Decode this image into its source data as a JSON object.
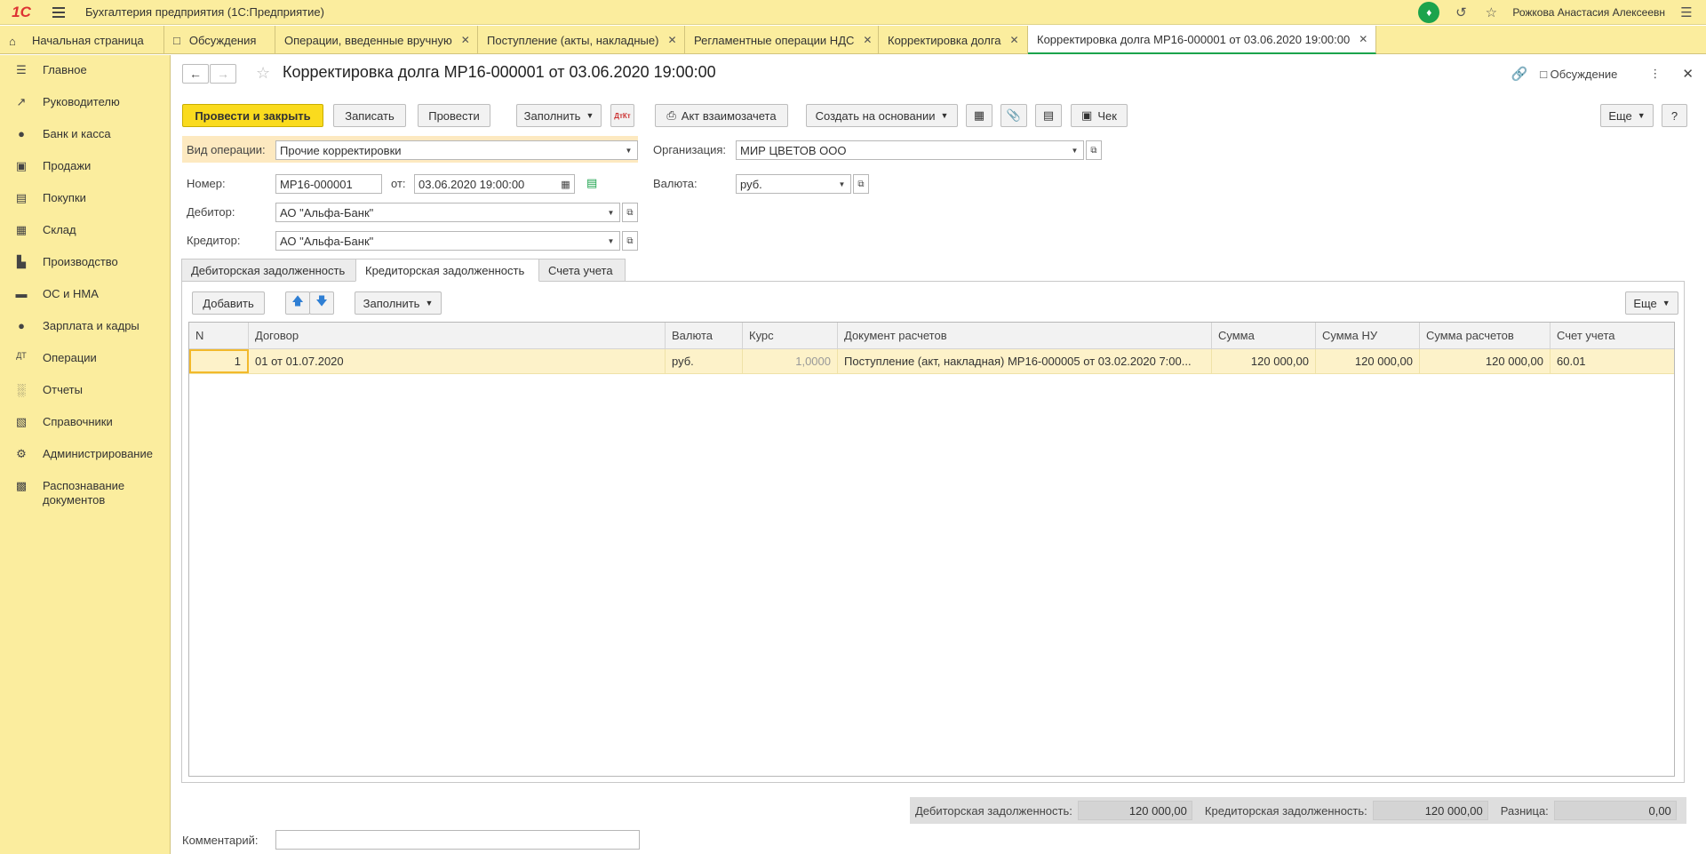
{
  "app": {
    "title": "Бухгалтерия предприятия  (1С:Предприятие)",
    "user": "Рожкова Анастасия Алексеевн"
  },
  "tabs": [
    {
      "label": "Начальная страница"
    },
    {
      "label": "Обсуждения"
    },
    {
      "label": "Операции, введенные вручную"
    },
    {
      "label": "Поступление (акты, накладные)"
    },
    {
      "label": "Регламентные операции НДС"
    },
    {
      "label": "Корректировка долга"
    },
    {
      "label": "Корректировка долга МР16-000001 от 03.06.2020 19:00:00"
    }
  ],
  "sidebar": {
    "items": [
      {
        "label": "Главное",
        "icon": "menu-icon"
      },
      {
        "label": "Руководителю",
        "icon": "trend-icon"
      },
      {
        "label": "Банк и касса",
        "icon": "ruble-icon"
      },
      {
        "label": "Продажи",
        "icon": "bag-icon"
      },
      {
        "label": "Покупки",
        "icon": "cart-icon"
      },
      {
        "label": "Склад",
        "icon": "warehouse-icon"
      },
      {
        "label": "Производство",
        "icon": "factory-icon"
      },
      {
        "label": "ОС и НМА",
        "icon": "truck-icon"
      },
      {
        "label": "Зарплата и кадры",
        "icon": "person-icon"
      },
      {
        "label": "Операции",
        "icon": "dt-kt-icon"
      },
      {
        "label": "Отчеты",
        "icon": "bar-chart-icon"
      },
      {
        "label": "Справочники",
        "icon": "book-icon"
      },
      {
        "label": "Администрирование",
        "icon": "gear-icon"
      },
      {
        "label": "Распознавание документов",
        "icon": "scan-icon"
      }
    ]
  },
  "doc": {
    "title": "Корректировка долга МР16-000001 от 03.06.2020 19:00:00",
    "discussion": "Обсуждение"
  },
  "toolbar": {
    "post_close": "Провести и закрыть",
    "save": "Записать",
    "post": "Провести",
    "fill": "Заполнить",
    "offset_act": "Акт взаимозачета",
    "create_based": "Создать на основании",
    "receipt": "Чек",
    "more": "Еще",
    "help": "?"
  },
  "form": {
    "op_type_label": "Вид операции:",
    "op_type_value": "Прочие корректировки",
    "org_label": "Организация:",
    "org_value": "МИР ЦВЕТОВ ООО",
    "number_label": "Номер:",
    "number_value": "МР16-000001",
    "from_label": "от:",
    "date_value": "03.06.2020 19:00:00",
    "currency_label": "Валюта:",
    "currency_value": "руб.",
    "debtor_label": "Дебитор:",
    "debtor_value": "АО \"Альфа-Банк\"",
    "creditor_label": "Кредитор:",
    "creditor_value": "АО \"Альфа-Банк\"",
    "comment_label": "Комментарий:",
    "comment_value": ""
  },
  "formtabs": [
    {
      "label": "Дебиторская задолженность"
    },
    {
      "label": "Кредиторская задолженность"
    },
    {
      "label": "Счета учета"
    }
  ],
  "table_toolbar": {
    "add": "Добавить",
    "fill": "Заполнить",
    "more": "Еще"
  },
  "table": {
    "columns": [
      "N",
      "Договор",
      "Валюта",
      "Курс",
      "Документ расчетов",
      "Сумма",
      "Сумма НУ",
      "Сумма расчетов",
      "Счет учета"
    ],
    "rows": [
      [
        "1",
        "01 от 01.07.2020",
        "руб.",
        "1,0000",
        "Поступление (акт, накладная) МР16-000005 от 03.02.2020 7:00...",
        "120 000,00",
        "120 000,00",
        "120 000,00",
        "60.01"
      ]
    ]
  },
  "totals": {
    "debit_label": "Дебиторская задолженность:",
    "debit_value": "120 000,00",
    "credit_label": "Кредиторская задолженность:",
    "credit_value": "120 000,00",
    "diff_label": "Разница:",
    "diff_value": "0,00"
  },
  "colors": {
    "accent": "#fadb1e",
    "panel": "#fbed9e",
    "active_tab": "#1ba34c",
    "row_selected": "#fdf2c9"
  }
}
